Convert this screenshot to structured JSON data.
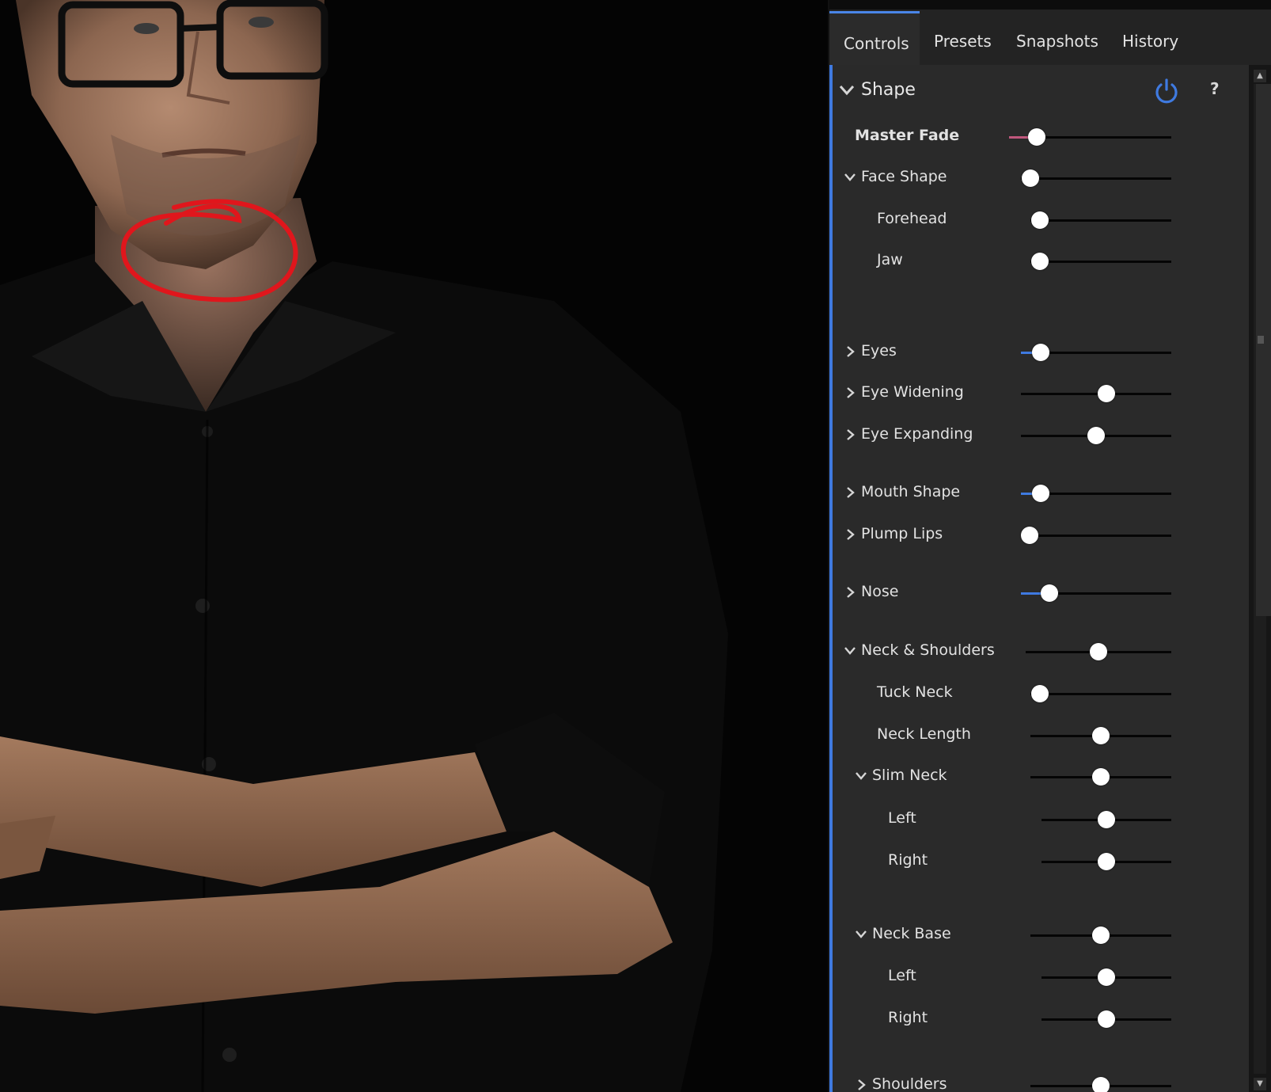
{
  "tabs": [
    {
      "label": "Controls",
      "active": true
    },
    {
      "label": "Presets",
      "active": false
    },
    {
      "label": "Snapshots",
      "active": false
    },
    {
      "label": "History",
      "active": false
    }
  ],
  "section": {
    "title": "Shape",
    "help_label": "?",
    "icons": {
      "power": "power-icon",
      "collapse": "chevron-down-icon"
    }
  },
  "colors": {
    "accent": "#3f7ae0",
    "master_fill": "#c0577d",
    "annotation": "#e0161c"
  },
  "rows": [
    {
      "label": "Master Fade",
      "chevron": "none",
      "bold": true,
      "value": 0.17
    },
    {
      "label": "Face Shape",
      "chevron": "down",
      "value": 0.0
    },
    {
      "label": "Forehead",
      "chevron": "none",
      "value": 0.0
    },
    {
      "label": "Jaw",
      "chevron": "none",
      "value": 0.0
    },
    {
      "label": "Eyes",
      "chevron": "right",
      "value": 0.13
    },
    {
      "label": "Eye Widening",
      "chevron": "right",
      "value": 0.57
    },
    {
      "label": "Eye Expanding",
      "chevron": "right",
      "value": 0.5
    },
    {
      "label": "Mouth Shape",
      "chevron": "right",
      "value": 0.13
    },
    {
      "label": "Plump Lips",
      "chevron": "right",
      "value": 0.06
    },
    {
      "label": "Nose",
      "chevron": "right",
      "value": 0.19
    },
    {
      "label": "Neck & Shoulders",
      "chevron": "down",
      "value": 0.5
    },
    {
      "label": "Tuck Neck",
      "chevron": "none",
      "value": 0.0
    },
    {
      "label": "Neck Length",
      "chevron": "none",
      "value": 0.5
    },
    {
      "label": "Slim Neck",
      "chevron": "down",
      "value": 0.5
    },
    {
      "label": "Left",
      "chevron": "none",
      "value": 0.5
    },
    {
      "label": "Right",
      "chevron": "none",
      "value": 0.5
    },
    {
      "label": "Neck Base",
      "chevron": "down",
      "value": 0.5
    },
    {
      "label": "Left",
      "chevron": "none",
      "value": 0.5
    },
    {
      "label": "Right",
      "chevron": "none",
      "value": 0.5
    },
    {
      "label": "Shoulders",
      "chevron": "right",
      "value": 0.5
    }
  ]
}
